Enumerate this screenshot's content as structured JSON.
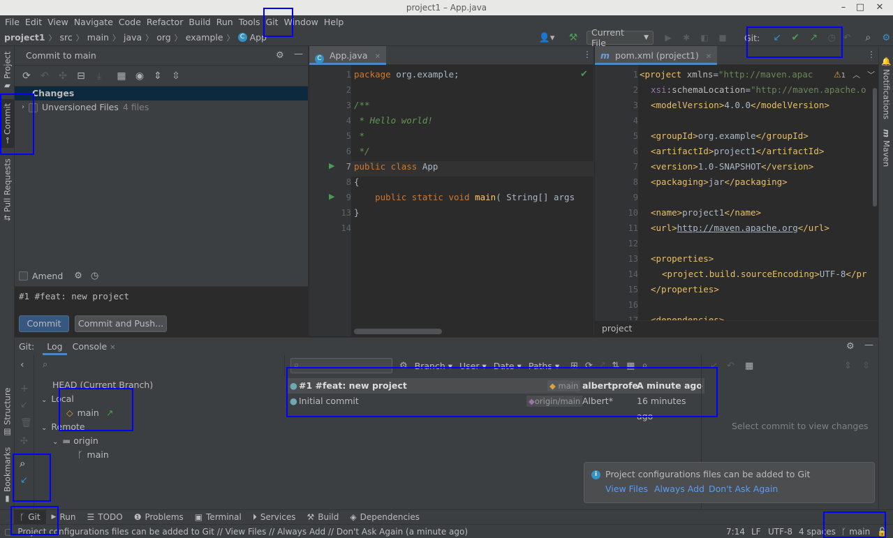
{
  "window": {
    "title": "project1 – App.java"
  },
  "menu": [
    "File",
    "Edit",
    "View",
    "Navigate",
    "Code",
    "Refactor",
    "Build",
    "Run",
    "Tools",
    "Git",
    "Window",
    "Help"
  ],
  "breadcrumb": [
    "project1",
    "src",
    "main",
    "java",
    "org",
    "example",
    "App"
  ],
  "nav": {
    "run_config": "Current File",
    "git_label": "Git:"
  },
  "left_strip": {
    "project": "Project",
    "commit": "Commit",
    "pull_requests": "Pull Requests",
    "structure": "Structure",
    "bookmarks": "Bookmarks"
  },
  "right_strip": {
    "notifications": "Notifications",
    "maven": "Maven"
  },
  "commit_panel": {
    "title": "Commit to main",
    "changes_label": "Changes",
    "unversioned_label": "Unversioned Files",
    "unversioned_count": "4 files",
    "amend_label": "Amend",
    "message": "#1 #feat: new project",
    "commit_button": "Commit",
    "commit_push_button": "Commit and Push..."
  },
  "editor_left": {
    "tab": "App.java",
    "line_numbers": [
      "1",
      "2",
      "3",
      "4",
      "5",
      "6",
      "7",
      "8",
      "9",
      "13",
      "14"
    ]
  },
  "editor_right": {
    "tab": "pom.xml (project1)",
    "warning_count": "1",
    "footer": "project",
    "line_numbers": [
      "1",
      "2",
      "3",
      "4",
      "5",
      "6",
      "7",
      "8",
      "9",
      "10",
      "11",
      "12",
      "13",
      "14",
      "15",
      "16",
      "17"
    ]
  },
  "git_panel": {
    "label": "Git:",
    "tab_log": "Log",
    "tab_console": "Console",
    "filters": [
      "Branch",
      "User",
      "Date",
      "Paths"
    ],
    "tree": {
      "head": "HEAD (Current Branch)",
      "local": "Local",
      "local_main": "main",
      "remote": "Remote",
      "origin": "origin",
      "origin_main": "main"
    },
    "commits": [
      {
        "message": "#1 #feat: new project",
        "ref": "main",
        "author": "albertprofe",
        "time": "A minute ago"
      },
      {
        "message": "Initial commit",
        "ref": "origin/main",
        "author": "Albert*",
        "time": "16 minutes ago"
      }
    ],
    "details_placeholder": "Select commit to view changes"
  },
  "notification": {
    "text": "Project configurations files can be added to Git",
    "actions": [
      "View Files",
      "Always Add",
      "Don't Ask Again"
    ]
  },
  "bottom_tools": [
    "Git",
    "Run",
    "TODO",
    "Problems",
    "Terminal",
    "Services",
    "Build",
    "Dependencies"
  ],
  "status": {
    "message": "Project configurations files can be added to Git // View Files // Always Add // Don't Ask Again (a minute ago)",
    "position": "7:14",
    "line_sep": "LF",
    "encoding": "UTF-8",
    "indent": "4 spaces",
    "branch": "main"
  },
  "colors": {
    "accent": "#4a88c7",
    "highlight_box": "#0000ff",
    "selection": "#0d293e",
    "link": "#589df6"
  }
}
